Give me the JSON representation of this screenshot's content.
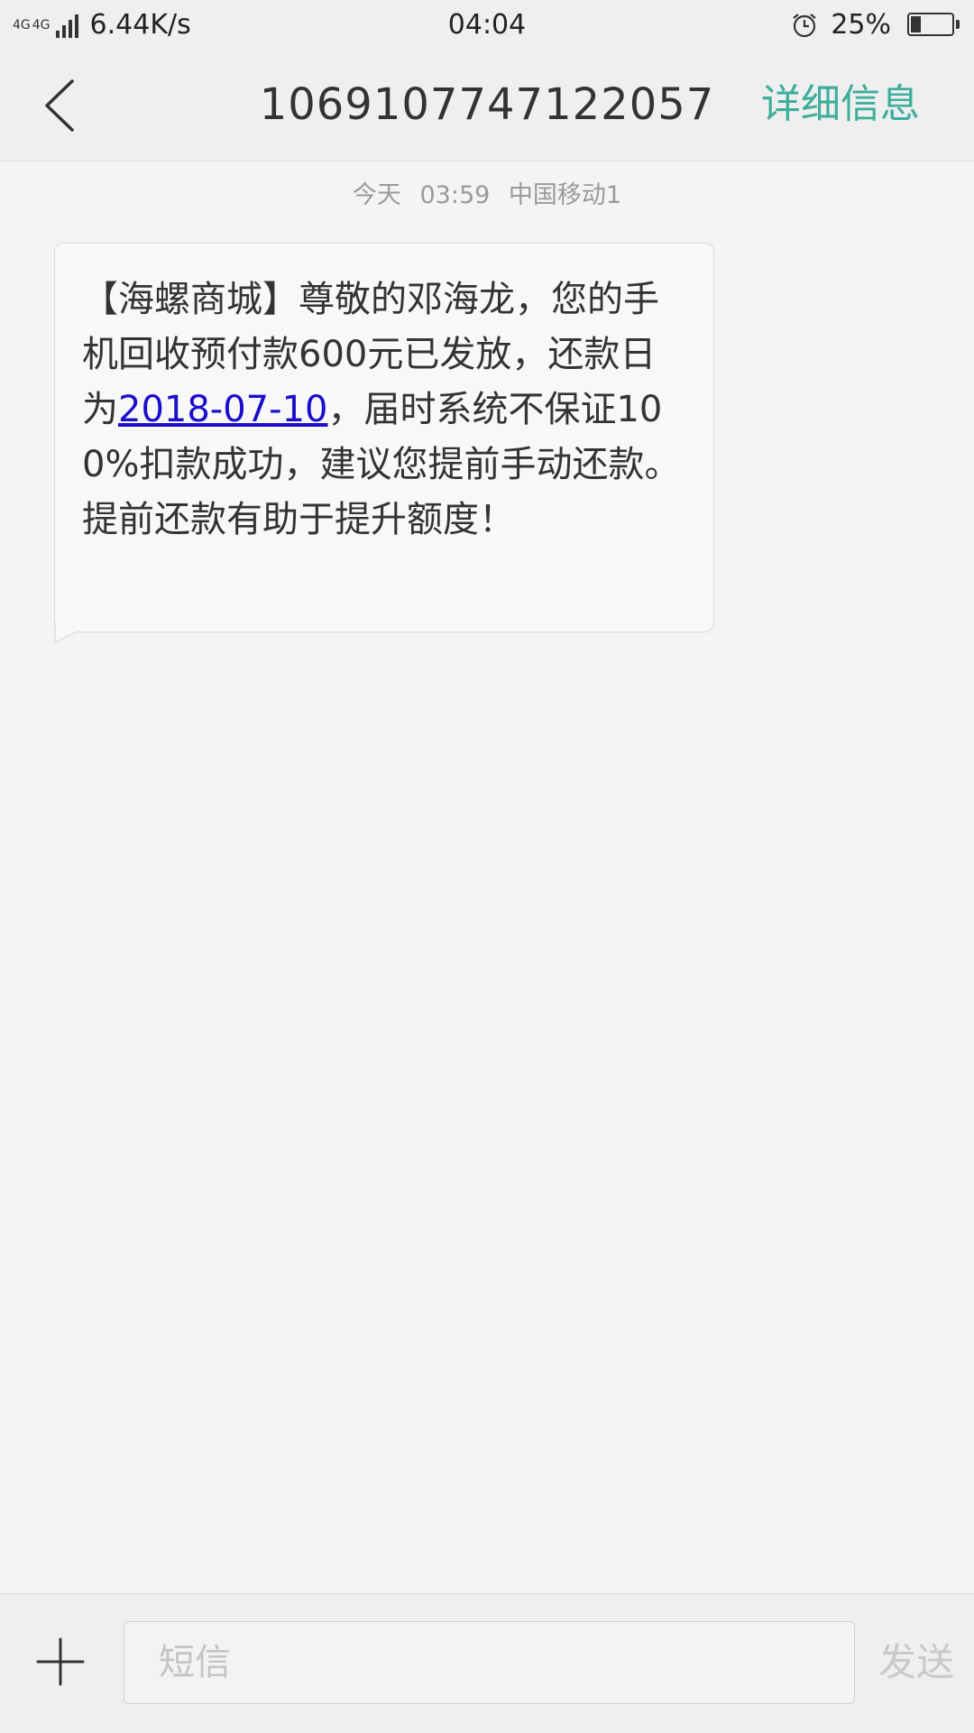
{
  "status_bar": {
    "network_1": "4G",
    "network_2": "4G",
    "speed": "6.44K/s",
    "time": "04:04",
    "battery_percent": "25%",
    "battery_level": 0.25,
    "icons": [
      "signal-icon",
      "alarm-icon",
      "battery-icon"
    ]
  },
  "header": {
    "title": "1069107747122057",
    "details_label": "详细信息",
    "accent_color": "#3cae9b"
  },
  "conversation": {
    "meta": {
      "day": "今天",
      "time": "03:59",
      "carrier": "中国移动1"
    },
    "message": {
      "text_before_link": "【海螺商城】尊敬的邓海龙，您的手机回收预付款600元已发放，还款日为",
      "link_text": "2018-07-10",
      "text_after_link": "，届时系统不保证100%扣款成功，建议您提前手动还款。提前还款有助于提升额度！"
    }
  },
  "compose": {
    "placeholder": "短信",
    "send_label": "发送"
  }
}
